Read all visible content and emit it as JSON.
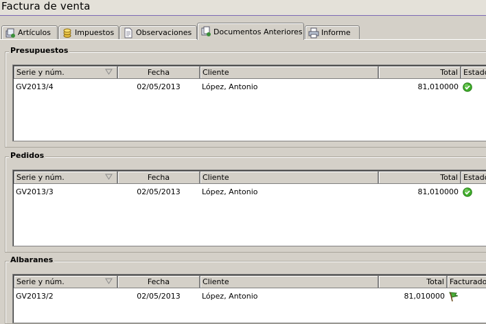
{
  "window": {
    "title": "Factura de venta"
  },
  "tabs": [
    {
      "label": "Artículos",
      "icon": "articles-icon",
      "active": false
    },
    {
      "label": "Impuestos",
      "icon": "coins-icon",
      "active": false
    },
    {
      "label": "Observaciones",
      "icon": "document-icon",
      "active": false
    },
    {
      "label": "Documentos Anteriores",
      "icon": "documents-icon",
      "active": true
    },
    {
      "label": "Informe",
      "icon": "printer-icon",
      "active": false
    }
  ],
  "groups": [
    {
      "title": "Presupuestos",
      "columns": [
        "Serie y núm.",
        "Fecha",
        "Cliente",
        "Total",
        "Estado"
      ],
      "rows": [
        {
          "serie": "GV2013/4",
          "fecha": "02/05/2013",
          "cliente": "López, Antonio",
          "total": "81,010000",
          "status_icon": "check-circle-icon"
        }
      ]
    },
    {
      "title": "Pedidos",
      "columns": [
        "Serie y núm.",
        "Fecha",
        "Cliente",
        "Total",
        "Estado"
      ],
      "rows": [
        {
          "serie": "GV2013/3",
          "fecha": "02/05/2013",
          "cliente": "López, Antonio",
          "total": "81,010000",
          "status_icon": "check-circle-icon"
        }
      ]
    },
    {
      "title": "Albaranes",
      "columns": [
        "Serie y núm.",
        "Fecha",
        "Cliente",
        "Total",
        "Facturado"
      ],
      "rows": [
        {
          "serie": "GV2013/2",
          "fecha": "02/05/2013",
          "cliente": "López, Antonio",
          "total": "81,010000",
          "status_icon": "green-flag-icon"
        }
      ]
    }
  ],
  "colors": {
    "window_bg": "#d4d0c8",
    "title_underline": "#7b68b5",
    "check_green": "#3fae2a"
  }
}
